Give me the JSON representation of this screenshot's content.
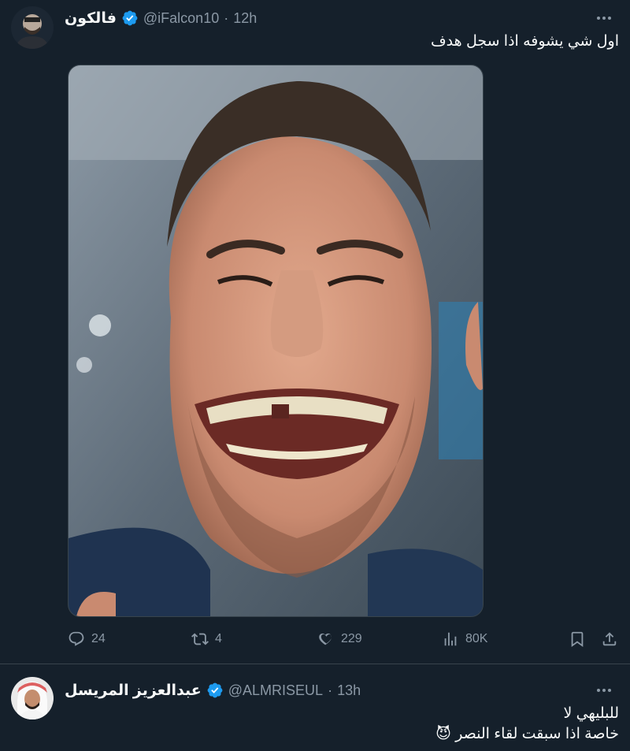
{
  "tweet1": {
    "display_name": "فالكون",
    "handle": "@iFalcon10",
    "separator": "·",
    "time": "12h",
    "text": "اول شي يشوفه اذا سجل هدف",
    "media_alt": "Close-up selfie of a smiling man with a chipped front tooth",
    "actions": {
      "replies": "24",
      "retweets": "4",
      "likes": "229",
      "views": "80K"
    }
  },
  "tweet2": {
    "display_name": "عبدالعزيز المريسل",
    "handle": "@ALMRISEUL",
    "separator": "·",
    "time": "13h",
    "line1": "للبليهي لا",
    "line2": "خاصة اذا سبقت لقاء النصر 😈"
  },
  "colors": {
    "background": "#15202b",
    "verified": "#1d9bf0",
    "secondary_text": "#8b98a5",
    "divider": "#38444d"
  }
}
